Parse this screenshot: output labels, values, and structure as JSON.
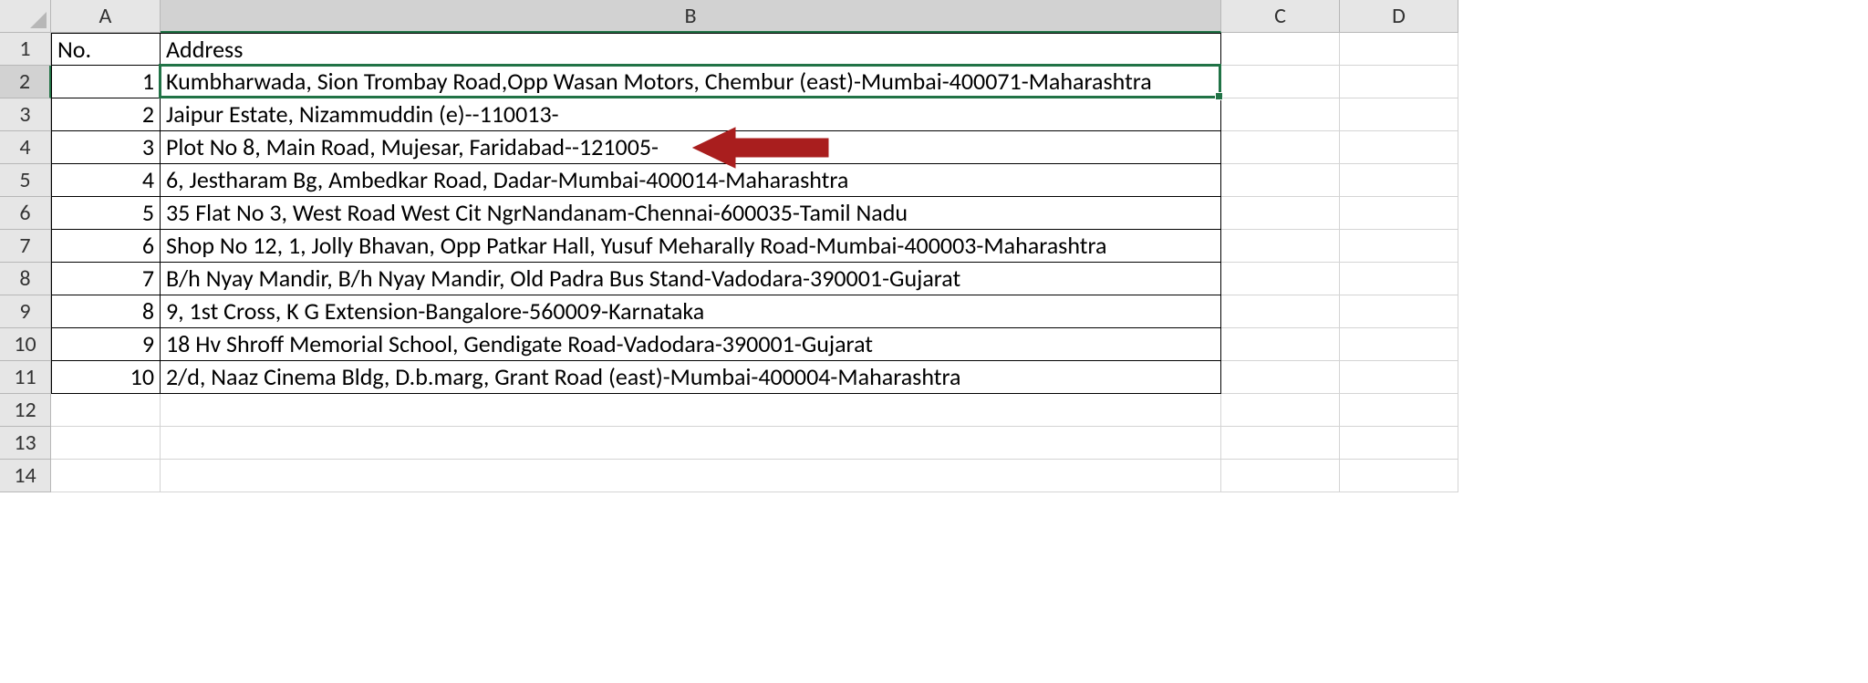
{
  "columns": [
    "A",
    "B",
    "C",
    "D"
  ],
  "row_count": 14,
  "selected_col_index": 1,
  "selected_row_index": 1,
  "headers": {
    "a": "No.",
    "b": "Address"
  },
  "rows": [
    {
      "no": "1",
      "addr": "Kumbharwada, Sion Trombay Road,Opp Wasan Motors, Chembur (east)-Mumbai-400071-Maharashtra"
    },
    {
      "no": "2",
      "addr": "Jaipur Estate, Nizammuddin (e)--110013-"
    },
    {
      "no": "3",
      "addr": "Plot No 8, Main Road, Mujesar, Faridabad--121005-"
    },
    {
      "no": "4",
      "addr": "6, Jestharam Bg, Ambedkar Road, Dadar-Mumbai-400014-Maharashtra"
    },
    {
      "no": "5",
      "addr": "35 Flat No 3, West Road West Cit NgrNandanam-Chennai-600035-Tamil Nadu"
    },
    {
      "no": "6",
      "addr": "Shop No 12, 1, Jolly Bhavan, Opp Patkar Hall, Yusuf Meharally Road-Mumbai-400003-Maharashtra"
    },
    {
      "no": "7",
      "addr": "B/h Nyay Mandir, B/h Nyay Mandir, Old Padra Bus Stand-Vadodara-390001-Gujarat"
    },
    {
      "no": "8",
      "addr": "9, 1st Cross, K G Extension-Bangalore-560009-Karnataka"
    },
    {
      "no": "9",
      "addr": "18 Hv Shroff Memorial School, Gendigate Road-Vadodara-390001-Gujarat"
    },
    {
      "no": "10",
      "addr": "2/d, Naaz Cinema Bldg, D.b.marg, Grant Road (east)-Mumbai-400004-Maharashtra"
    }
  ],
  "annotation": {
    "type": "arrow",
    "color": "#A91E1E",
    "target_row": 3
  }
}
